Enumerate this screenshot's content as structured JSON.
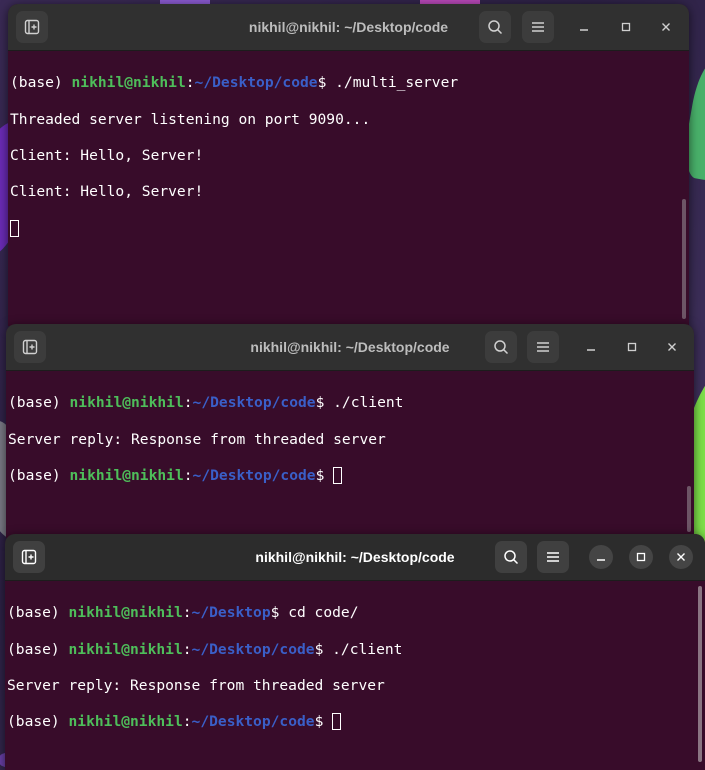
{
  "windows": [
    {
      "title": "nikhil@nikhil: ~/Desktop/code",
      "lines": [
        {
          "prefix": "(base) ",
          "user": "nikhil@nikhil",
          "colon": ":",
          "path": "~/Desktop/code",
          "prompt": "$ ",
          "cmd": "./multi_server"
        },
        {
          "text": "Threaded server listening on port 9090..."
        },
        {
          "text": "Client: Hello, Server!"
        },
        {
          "text": "Client: Hello, Server!"
        }
      ]
    },
    {
      "title": "nikhil@nikhil: ~/Desktop/code",
      "lines": [
        {
          "prefix": "(base) ",
          "user": "nikhil@nikhil",
          "colon": ":",
          "path": "~/Desktop/code",
          "prompt": "$ ",
          "cmd": "./client"
        },
        {
          "text": "Server reply: Response from threaded server"
        },
        {
          "prefix": "(base) ",
          "user": "nikhil@nikhil",
          "colon": ":",
          "path": "~/Desktop/code",
          "prompt": "$ ",
          "cmd": ""
        }
      ]
    },
    {
      "title": "nikhil@nikhil: ~/Desktop/code",
      "lines": [
        {
          "prefix": "(base) ",
          "user": "nikhil@nikhil",
          "colon": ":",
          "path": "~/Desktop",
          "prompt": "$ ",
          "cmd": "cd code/"
        },
        {
          "prefix": "(base) ",
          "user": "nikhil@nikhil",
          "colon": ":",
          "path": "~/Desktop/code",
          "prompt": "$ ",
          "cmd": "./client"
        },
        {
          "text": "Server reply: Response from threaded server"
        },
        {
          "prefix": "(base) ",
          "user": "nikhil@nikhil",
          "colon": ":",
          "path": "~/Desktop/code",
          "prompt": "$ ",
          "cmd": ""
        }
      ]
    }
  ],
  "icons": {
    "new_tab": "new-tab-icon",
    "search": "search-icon",
    "menu": "hamburger-menu-icon",
    "minimize": "minimize-icon",
    "maximize": "maximize-icon",
    "close": "close-icon"
  },
  "colors": {
    "terminal_bg": "#380c2a",
    "user_green": "#4ebe5a",
    "path_blue": "#3a5fc8",
    "titlebar": "#303030"
  }
}
